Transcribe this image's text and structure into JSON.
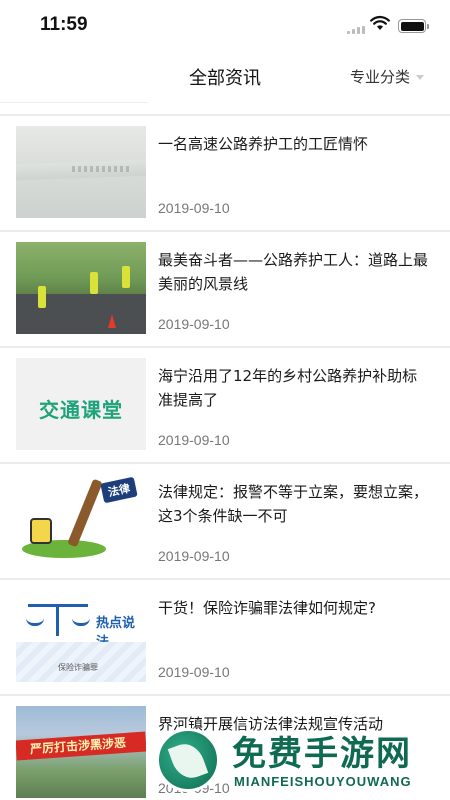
{
  "status_bar": {
    "time": "11:59",
    "icons": [
      "cellular-signal-icon",
      "wifi-icon",
      "battery-icon"
    ]
  },
  "header": {
    "title": "全部资讯",
    "filter_label": "专业分类",
    "filter_icon": "chevron-down-icon"
  },
  "news": [
    {
      "title": "一名高速公路养护工的工匠情怀",
      "date": "2019-09-10"
    },
    {
      "title": "最美奋斗者——公路养护工人：道路上最美丽的风景线",
      "date": "2019-09-10"
    },
    {
      "title": "海宁沿用了12年的乡村公路养护补助标准提高了",
      "date": "2019-09-10"
    },
    {
      "title": "法律规定：报警不等于立案，要想立案，这3个条件缺一不可",
      "date": "2019-09-10"
    },
    {
      "title": "干货！保险诈骗罪法律如何规定?",
      "date": "2019-09-10"
    },
    {
      "title": "界河镇开展信访法律法规宣传活动",
      "date": "2019-09-10"
    }
  ],
  "thumbnails": {
    "t3_logo": "交通课堂",
    "t4_stamp": "法律",
    "t5_heading": "热点说法",
    "t5_caption": "保险诈骗罪",
    "t6_banner": "严厉打击涉黑涉恶"
  },
  "watermark": {
    "main": "免费手游网",
    "sub": "MIANFEISHOUYOUWANG"
  },
  "colors": {
    "accent_green": "#0f6a52",
    "divider": "#ececec",
    "date_gray": "#777777"
  }
}
